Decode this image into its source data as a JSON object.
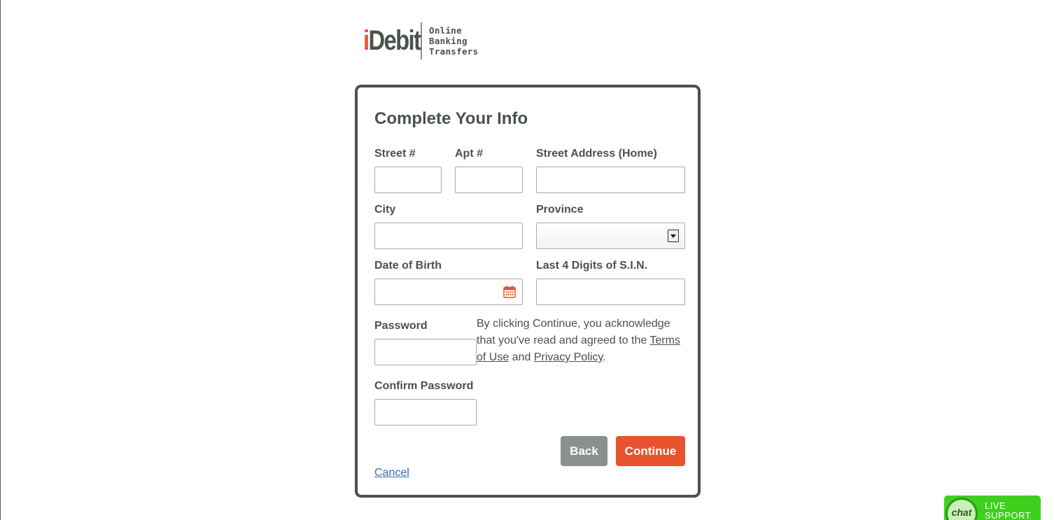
{
  "logo": {
    "brand_prefix": "i",
    "brand_rest": "Debit",
    "tagline": [
      "Online",
      "Banking",
      "Transfers"
    ]
  },
  "form": {
    "title": "Complete Your Info",
    "street_number_label": "Street #",
    "apt_label": "Apt #",
    "street_address_label": "Street Address (Home)",
    "city_label": "City",
    "province_label": "Province",
    "dob_label": "Date of Birth",
    "sin_label": "Last 4 Digits of S.I.N.",
    "password_label": "Password",
    "confirm_password_label": "Confirm Password",
    "terms": {
      "prefix": "By clicking Continue, you acknowledge that you've read and agreed to the ",
      "terms_link": "Terms of Use",
      "middle": " and ",
      "privacy_link": "Privacy Policy",
      "suffix": "."
    },
    "back_label": "Back",
    "continue_label": "Continue",
    "cancel_label": "Cancel"
  },
  "chat": {
    "bubble_text": "chat",
    "line1": "LIVE",
    "line2": "SUPPORT"
  },
  "colors": {
    "accent": "#e8532f",
    "text": "#4a524c",
    "back_button": "#8a918c",
    "link": "#3a6db3",
    "chat_green": "#3fcf1f"
  },
  "icons": {
    "select_arrow": "chevron-down-icon",
    "date": "calendar-icon"
  }
}
